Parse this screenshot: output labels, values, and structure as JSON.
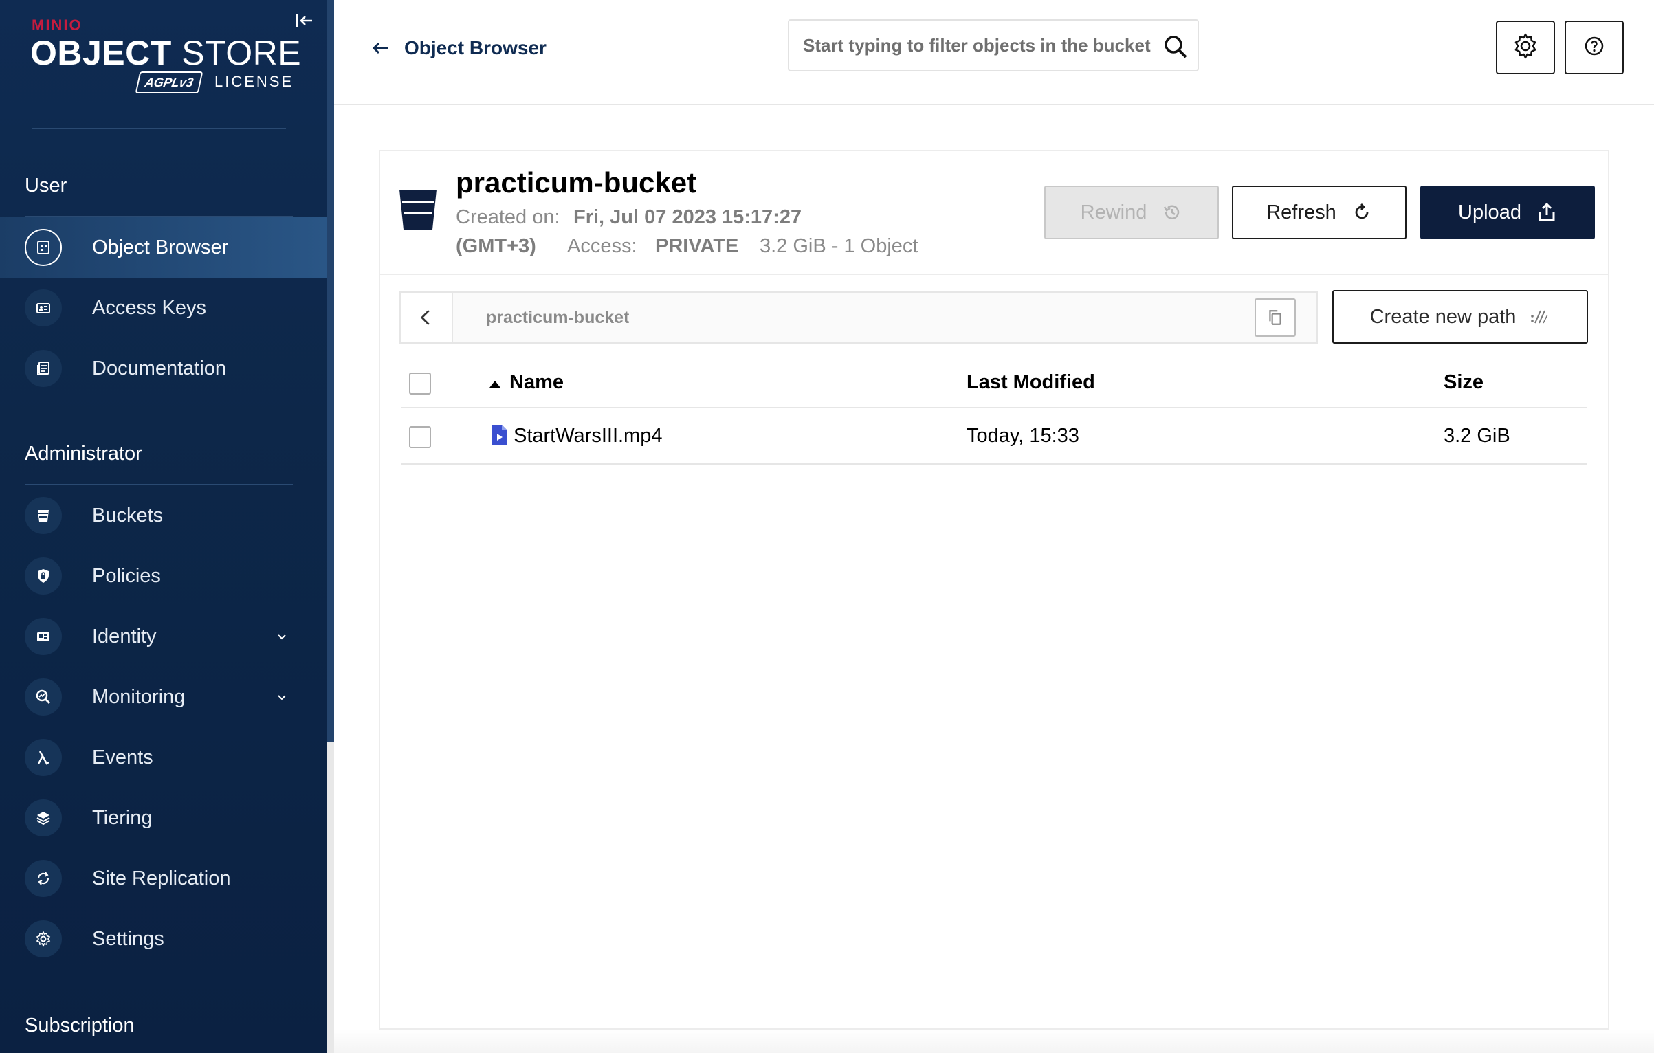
{
  "sidebar": {
    "brand": "MINIO",
    "title_bold": "OBJECT",
    "title_light": " STORE",
    "badge": "AGPLv3",
    "license": "LICENSE",
    "sections": {
      "user": "User",
      "administrator": "Administrator",
      "subscription": "Subscription"
    },
    "user_items": [
      {
        "label": "Object Browser",
        "icon": "object-browser-icon",
        "active": true
      },
      {
        "label": "Access Keys",
        "icon": "access-keys-icon"
      },
      {
        "label": "Documentation",
        "icon": "documentation-icon"
      }
    ],
    "admin_items": [
      {
        "label": "Buckets",
        "icon": "bucket-icon"
      },
      {
        "label": "Policies",
        "icon": "shield-lock-icon"
      },
      {
        "label": "Identity",
        "icon": "id-card-icon",
        "expandable": true
      },
      {
        "label": "Monitoring",
        "icon": "magnifier-chart-icon",
        "expandable": true
      },
      {
        "label": "Events",
        "icon": "lambda-icon"
      },
      {
        "label": "Tiering",
        "icon": "layers-icon"
      },
      {
        "label": "Site Replication",
        "icon": "replication-icon"
      },
      {
        "label": "Settings",
        "icon": "gear-icon"
      }
    ]
  },
  "header": {
    "title": "Object Browser",
    "search_placeholder": "Start typing to filter objects in the bucket"
  },
  "bucket": {
    "name": "practicum-bucket",
    "created_label": "Created on:",
    "created_value": "Fri, Jul 07 2023 15:17:27",
    "timezone": "(GMT+3)",
    "access_label": "Access:",
    "access_value": "PRIVATE",
    "usage": "3.2 GiB - 1 Object"
  },
  "actions": {
    "rewind": "Rewind",
    "refresh": "Refresh",
    "upload": "Upload",
    "create_path": "Create new path"
  },
  "breadcrumb": {
    "path": "practicum-bucket"
  },
  "table": {
    "columns": [
      "Name",
      "Last Modified",
      "Size"
    ],
    "rows": [
      {
        "name": "StartWarsIII.mp4",
        "modified": "Today, 15:33",
        "size": "3.2 GiB"
      }
    ]
  },
  "colors": {
    "sidebar_bg": "#0f2b52",
    "brand_red": "#c51c3f",
    "primary_button": "#0d1e3d",
    "file_icon": "#3a4fd0"
  }
}
